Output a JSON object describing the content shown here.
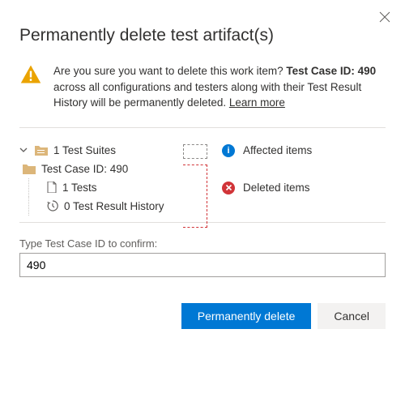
{
  "dialog": {
    "title": "Permanently delete test artifact(s)"
  },
  "warning": {
    "text_prefix": "Are you sure you want to delete this work item? ",
    "bold_text": "Test Case ID: 490",
    "text_suffix": " across all configurations and testers along with their Test Result History will be permanently deleted. ",
    "learn_more": "Learn more"
  },
  "tree": {
    "suites": "1 Test Suites",
    "testcase": "Test Case ID: 490",
    "tests": "1 Tests",
    "history": "0 Test Result History"
  },
  "legend": {
    "affected": "Affected items",
    "deleted": "Deleted items"
  },
  "confirm": {
    "label": "Type Test Case ID to confirm:",
    "value": "490"
  },
  "footer": {
    "primary": "Permanently delete",
    "cancel": "Cancel"
  },
  "colors": {
    "primary": "#0078d4",
    "danger": "#d13438",
    "warning": "#eaa300",
    "folder": "#dcb67a"
  }
}
